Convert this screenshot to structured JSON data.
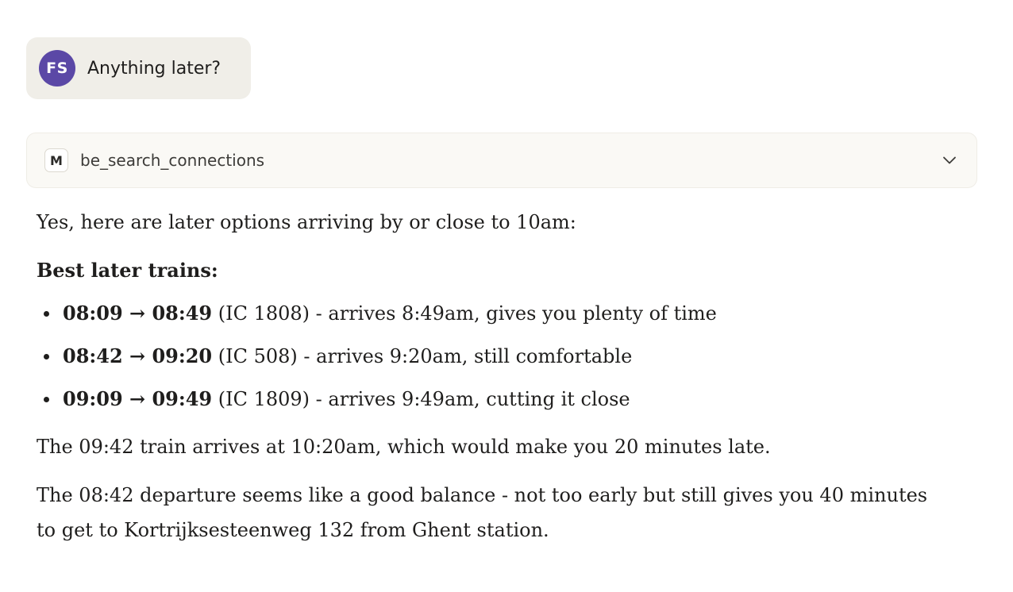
{
  "user_message": {
    "avatar_initials": "FS",
    "avatar_color": "#5b48a6",
    "text": "Anything later?"
  },
  "tool_call": {
    "icon_letter": "M",
    "name": "be_search_connections",
    "icon": "chevron-down-icon"
  },
  "response": {
    "intro": "Yes, here are later options arriving by or close to 10am:",
    "heading": "Best later trains:",
    "trains": [
      {
        "time": "08:09 → 08:49",
        "detail": " (IC 1808) - arrives 8:49am, gives you plenty of time"
      },
      {
        "time": "08:42 → 09:20",
        "detail": " (IC 508) - arrives 9:20am, still comfortable"
      },
      {
        "time": "09:09 → 09:49",
        "detail": " (IC 1809) - arrives 9:49am, cutting it close"
      }
    ],
    "note": "The 09:42 train arrives at 10:20am, which would make you 20 minutes late.",
    "conclusion": "The 08:42 departure seems like a good balance - not too early but still gives you 40 minutes to get to Kortrijksesteenweg 132 from Ghent station."
  }
}
